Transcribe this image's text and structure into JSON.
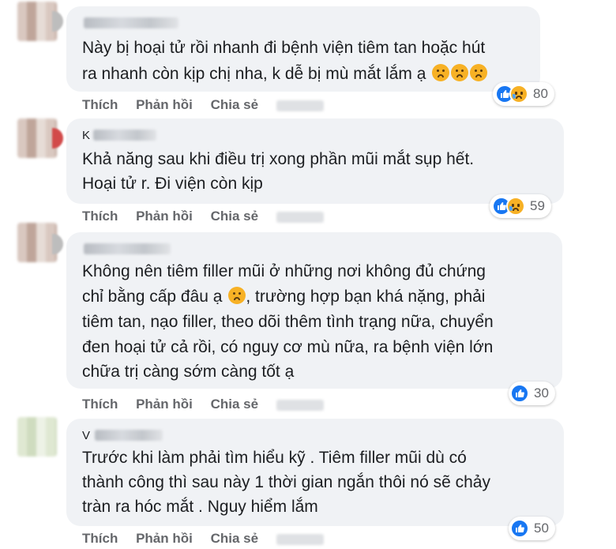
{
  "actions": {
    "like": "Thích",
    "reply": "Phản hồi",
    "share": "Chia sẻ"
  },
  "comments": [
    {
      "lines": [
        "Này bị hoại tử rồi nhanh đi bệnh viện tiêm tan hoặc hút",
        "ra nhanh còn kịp chị nha, k dễ bị mù mắt lắm ạ"
      ],
      "reaction_count": "80"
    },
    {
      "name_partial": "K",
      "lines": [
        "Khả năng sau khi điều trị xong phần mũi mắt sụp hết.",
        "Hoại tử r. Đi viện còn kịp"
      ],
      "reaction_count": "59"
    },
    {
      "lines": [
        "Không nên tiêm filler mũi ở những nơi không đủ chứng",
        "chỉ bằng cấp đâu ạ",
        ", trường hợp bạn khá nặng, phải",
        "tiêm tan, nạo filler, theo dõi thêm tình trạng nữa, chuyển",
        "đen hoại tử cả rồi, có nguy cơ mù nữa, ra bệnh viện lớn",
        "chữa trị càng sớm càng tốt ạ"
      ],
      "reaction_count": "30"
    },
    {
      "name_partial": "V",
      "lines": [
        "Trước khi làm phải tìm hiểu kỹ . Tiêm filler mũi dù có",
        "thành công thì sau này 1 thời gian ngắn thôi nó sẽ chảy",
        "tràn ra hóc mắt . Nguy hiểm lắm"
      ],
      "reaction_count": "50"
    }
  ],
  "colors": {
    "bubble": "#f0f2f5",
    "like": "#1877f2",
    "sad": "#f7b125",
    "meta": "#65676b"
  }
}
